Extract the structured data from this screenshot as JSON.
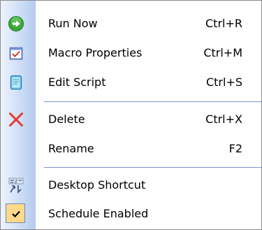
{
  "menu": {
    "items": [
      {
        "label": "Run Now",
        "shortcut": "Ctrl+R",
        "icon": "run-icon"
      },
      {
        "label": "Macro Properties",
        "shortcut": "Ctrl+M",
        "icon": "properties-icon"
      },
      {
        "label": "Edit Script",
        "shortcut": "Ctrl+S",
        "icon": "script-icon"
      },
      {
        "label": "Delete",
        "shortcut": "Ctrl+X",
        "icon": "delete-icon"
      },
      {
        "label": "Rename",
        "shortcut": "F2",
        "icon": ""
      },
      {
        "label": "Desktop Shortcut",
        "shortcut": "",
        "icon": "desktop-shortcut-icon"
      },
      {
        "label": "Schedule Enabled",
        "shortcut": "",
        "icon": "checkmark-icon",
        "checked": true
      }
    ]
  },
  "colors": {
    "gutter_light": "#eef3fc",
    "gutter_dark": "#b3c9ee",
    "separator": "#7a96c8",
    "run_green": "#3aa43a",
    "delete_red": "#e23b2e",
    "check_highlight": "#ffd98a"
  }
}
